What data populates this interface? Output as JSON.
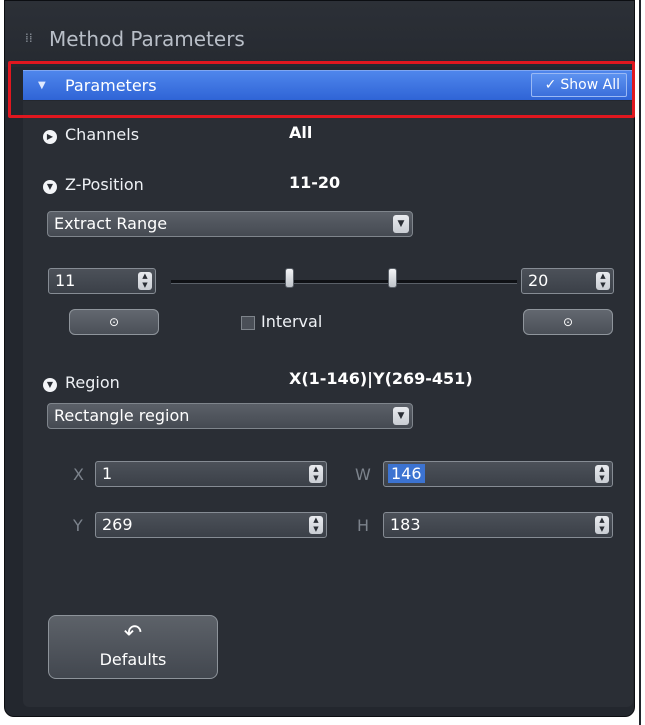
{
  "panel": {
    "title": "Method Parameters",
    "section_title": "Parameters",
    "show_all_label": "Show All"
  },
  "channels": {
    "label": "Channels",
    "value": "All"
  },
  "z_position": {
    "label": "Z-Position",
    "value": "11-20",
    "mode_dropdown": "Extract Range",
    "start_value": "11",
    "end_value": "20",
    "interval_label": "Interval",
    "interval_checked": false,
    "slider_range": {
      "min": 1,
      "max": 30,
      "low": 11,
      "high": 20
    }
  },
  "region": {
    "label": "Region",
    "value": "X(1-146)|Y(269-451)",
    "shape_dropdown": "Rectangle region",
    "x_label": "X",
    "x_value": "1",
    "y_label": "Y",
    "y_value": "269",
    "w_label": "W",
    "w_value": "146",
    "h_label": "H",
    "h_value": "183"
  },
  "defaults_button": {
    "label": "Defaults",
    "icon": "undo-icon"
  },
  "colors": {
    "accent_blue": "#3a6fdc",
    "panel_bg": "#2a2e35",
    "highlight_red": "#e0171f"
  }
}
